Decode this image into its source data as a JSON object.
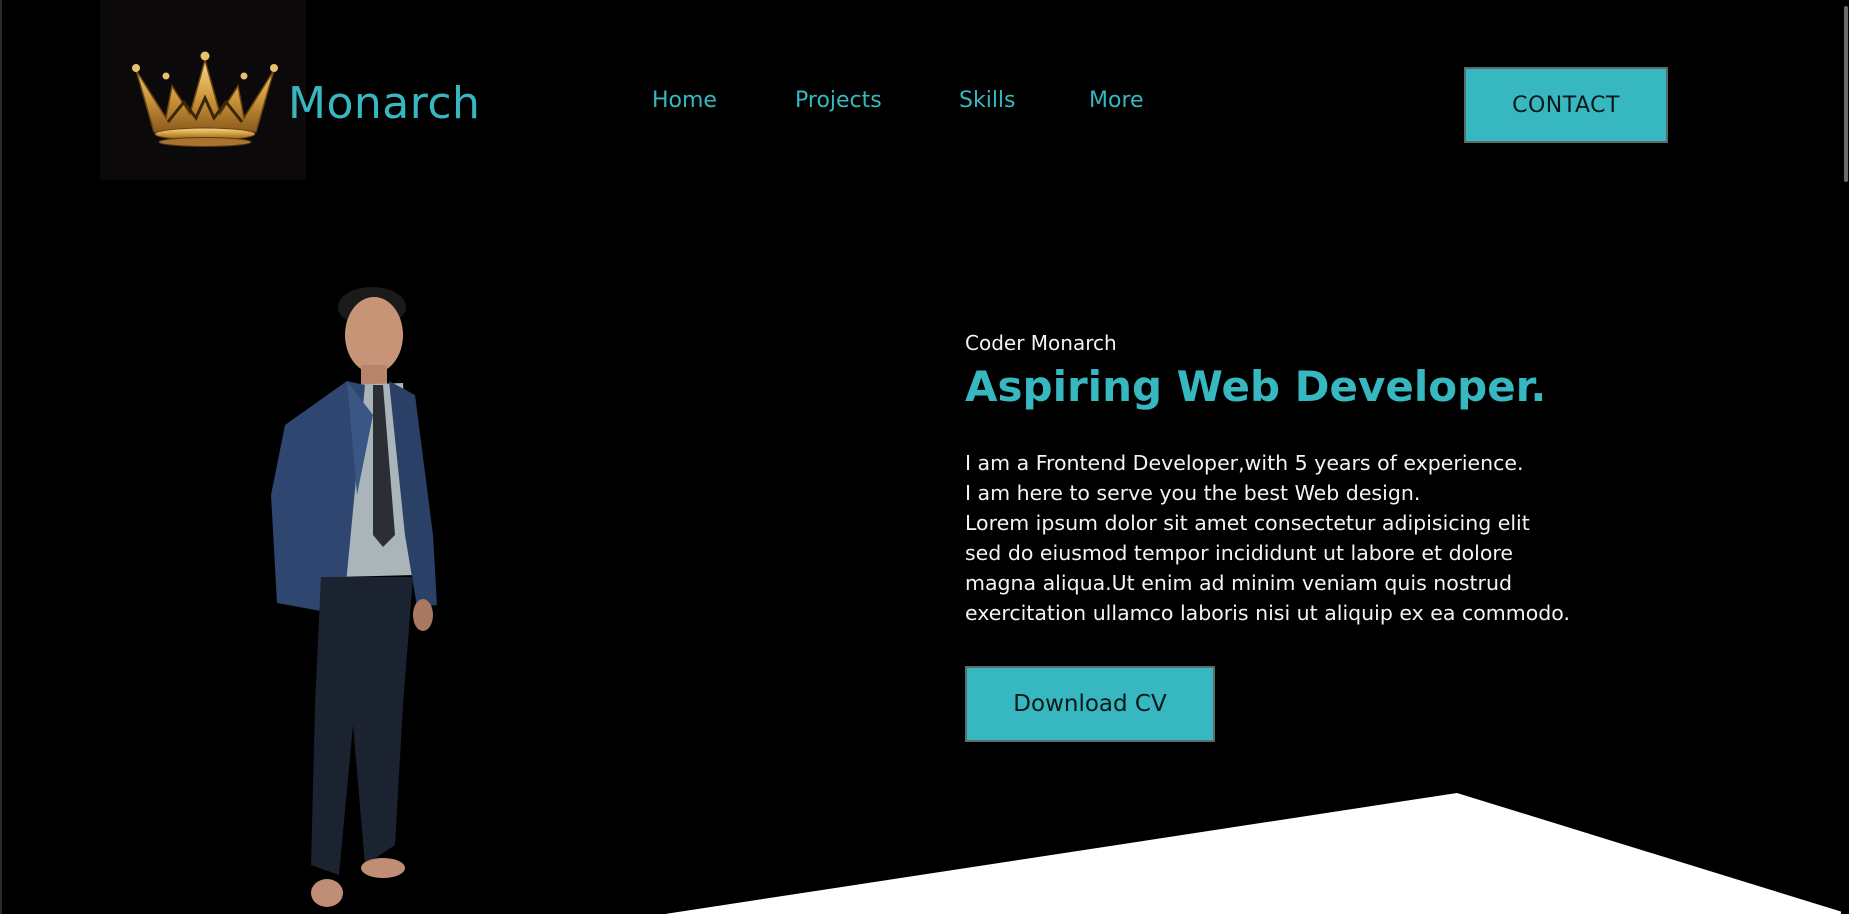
{
  "header": {
    "brand": "Monarch",
    "nav": [
      {
        "label": "Home"
      },
      {
        "label": "Projects"
      },
      {
        "label": "Skills"
      },
      {
        "label": "More"
      }
    ],
    "contact_label": "CONTACT"
  },
  "hero": {
    "eyebrow": "Coder Monarch",
    "title": "Aspiring Web Developer.",
    "body_lines": [
      "I am a Frontend Developer,with 5 years of experience.",
      "I am here to serve you the best Web design.",
      "Lorem ipsum dolor sit amet consectetur adipisicing elit",
      "sed do eiusmod tempor incididunt ut labore et dolore",
      "magna aliqua.Ut enim ad minim veniam quis nostrud",
      "exercitation ullamco laboris nisi ut aliquip ex ea commodo."
    ],
    "download_label": "Download CV"
  },
  "colors": {
    "accent": "#37b7bf",
    "background": "#000000",
    "text": "#f4f4f4",
    "logo_gold": "#d9a64a"
  },
  "icons": {
    "logo": "crown-icon"
  }
}
